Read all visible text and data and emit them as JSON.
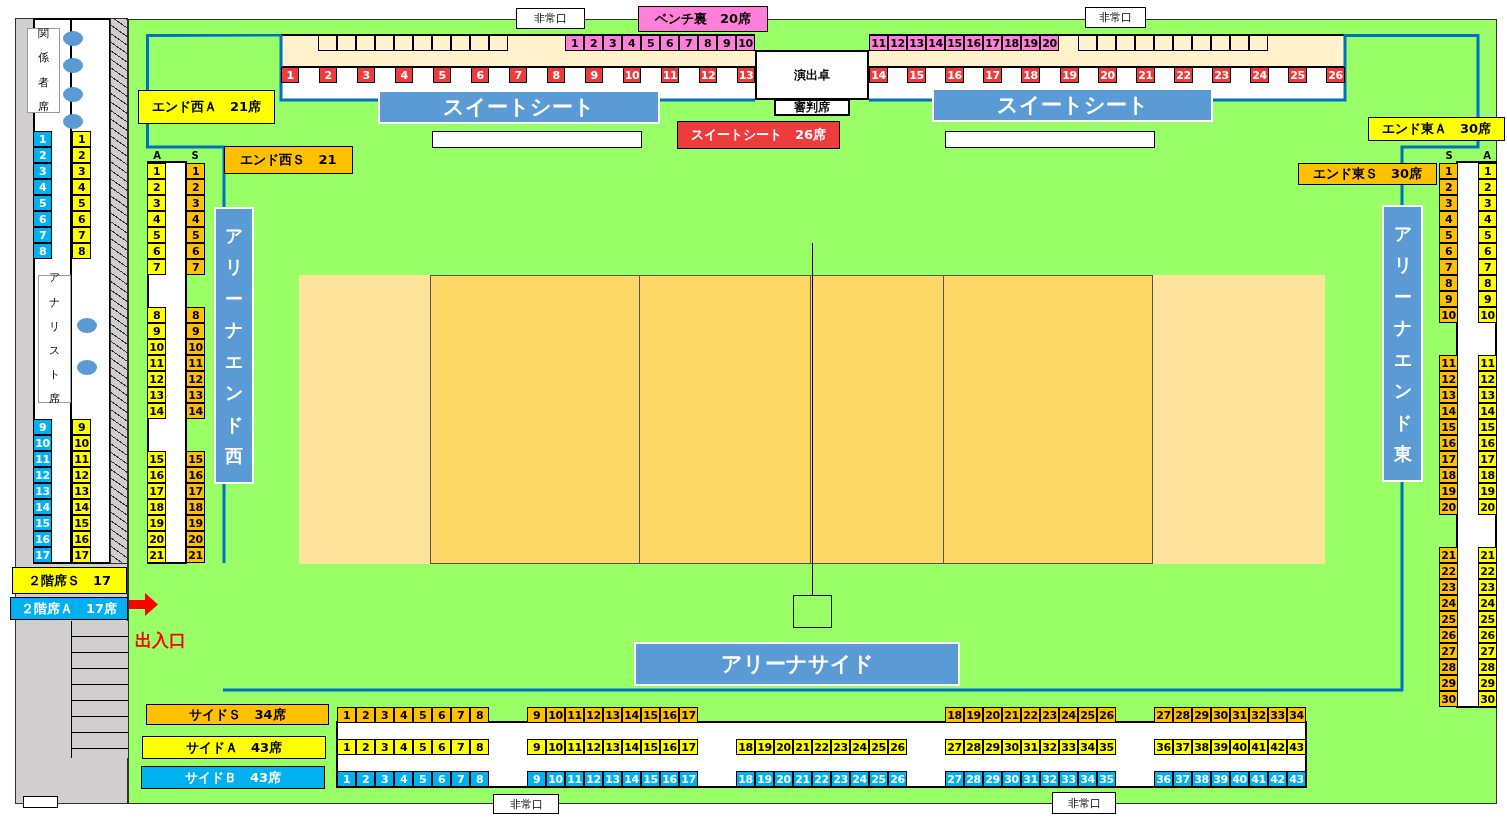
{
  "exits": [
    "非常口",
    "非常口",
    "非常口",
    "非常口"
  ],
  "signs": [
    {
      "text": "ベンチ裏　20席",
      "color": "#ff7fd9"
    },
    {
      "text": "エンド西Ａ　21席",
      "color": "#ffff00"
    },
    {
      "text": "スイートシート　26席",
      "color": "#ee3b3b"
    },
    {
      "text": "エンド東Ａ　30席",
      "color": "#ffff00"
    },
    {
      "text": "エンド西Ｓ　21",
      "color": "#ffc000"
    },
    {
      "text": "エンド東Ｓ　30席",
      "color": "#ffc000"
    },
    {
      "text": "２階席Ｓ　17",
      "color": "#ffff00"
    },
    {
      "text": "２階席Ａ　17席",
      "color": "#00b0f0"
    },
    {
      "text": "サイドＳ　34席",
      "color": "#ffc000"
    },
    {
      "text": "サイドＡ　43席",
      "color": "#ffff00"
    },
    {
      "text": "サイドＢ　43席",
      "color": "#00b0f0"
    }
  ],
  "zones": [
    {
      "text": "スイートシート",
      "kind": "horizontal"
    },
    {
      "text": "スイートシート",
      "kind": "horizontal"
    },
    {
      "text": "アリーナエンド西",
      "kind": "vertical"
    },
    {
      "text": "アリーナエンド東",
      "kind": "vertical"
    },
    {
      "text": "アリーナサイド",
      "kind": "horizontal"
    }
  ],
  "rooms": [
    {
      "text": "関係者席",
      "kind": "vertical"
    },
    {
      "text": "アナリスト席",
      "kind": "vertical"
    },
    {
      "text": "演出卓",
      "kind": "horizontal"
    },
    {
      "text": "審判席",
      "kind": "horizontal"
    }
  ],
  "column_heads": [
    "A",
    "S",
    "S",
    "A"
  ],
  "entrance": "出入口",
  "seat_blocks": [
    {
      "color": "#ff7fd9",
      "seats": [
        "1",
        "2",
        "3",
        "4",
        "5",
        "6",
        "7",
        "8",
        "9",
        "10"
      ]
    },
    {
      "color": "#ff7fd9",
      "seats": [
        "11",
        "12",
        "13",
        "14",
        "15",
        "16",
        "17",
        "18",
        "19",
        "20"
      ]
    },
    {
      "color": "#ee3b3b",
      "seats": [
        "1",
        "2",
        "3",
        "4",
        "5",
        "6",
        "7",
        "8",
        "9",
        "10",
        "11",
        "12",
        "13"
      ]
    },
    {
      "color": "#ee3b3b",
      "seats": [
        "14",
        "15",
        "16",
        "17",
        "18",
        "19",
        "20",
        "21",
        "22",
        "23",
        "24",
        "25",
        "26"
      ]
    },
    {
      "color": "#00b0f0",
      "seats": [
        "1",
        "2",
        "3",
        "4",
        "5",
        "6",
        "7",
        "8"
      ]
    },
    {
      "color": "#00b0f0",
      "seats": [
        "9",
        "10",
        "11",
        "12",
        "13",
        "14",
        "15",
        "16",
        "17"
      ]
    },
    {
      "color": "#ffff00",
      "seats": [
        "1",
        "2",
        "3",
        "4",
        "5",
        "6",
        "7",
        "8"
      ]
    },
    {
      "color": "#ffff00",
      "seats": [
        "9",
        "10",
        "11",
        "12",
        "13",
        "14",
        "15",
        "16",
        "17"
      ]
    },
    {
      "color": "#ffff00",
      "seats": [
        "1",
        "2",
        "3",
        "4",
        "5",
        "6",
        "7"
      ]
    },
    {
      "color": "#ffff00",
      "seats": [
        "8",
        "9",
        "10",
        "11",
        "12",
        "13",
        "14"
      ]
    },
    {
      "color": "#ffff00",
      "seats": [
        "15",
        "16",
        "17",
        "18",
        "19",
        "20",
        "21"
      ]
    },
    {
      "color": "#ffc000",
      "seats": [
        "1",
        "2",
        "3",
        "4",
        "5",
        "6",
        "7"
      ]
    },
    {
      "color": "#ffc000",
      "seats": [
        "8",
        "9",
        "10",
        "11",
        "12",
        "13",
        "14"
      ]
    },
    {
      "color": "#ffc000",
      "seats": [
        "15",
        "16",
        "17",
        "18",
        "19",
        "20",
        "21"
      ]
    },
    {
      "color": "#ffc000",
      "seats": [
        "1",
        "2",
        "3",
        "4",
        "5",
        "6",
        "7",
        "8",
        "9",
        "10"
      ]
    },
    {
      "color": "#ffc000",
      "seats": [
        "11",
        "12",
        "13",
        "14",
        "15",
        "16",
        "17",
        "18",
        "19",
        "20"
      ]
    },
    {
      "color": "#ffc000",
      "seats": [
        "21",
        "22",
        "23",
        "24",
        "25",
        "26",
        "27",
        "28",
        "29",
        "30"
      ]
    },
    {
      "color": "#ffff00",
      "seats": [
        "1",
        "2",
        "3",
        "4",
        "5",
        "6",
        "7",
        "8",
        "9",
        "10"
      ]
    },
    {
      "color": "#ffff00",
      "seats": [
        "11",
        "12",
        "13",
        "14",
        "15",
        "16",
        "17",
        "18",
        "19",
        "20"
      ]
    },
    {
      "color": "#ffff00",
      "seats": [
        "21",
        "22",
        "23",
        "24",
        "25",
        "26",
        "27",
        "28",
        "29",
        "30"
      ]
    },
    {
      "color": "#ffc000",
      "seats": [
        "1",
        "2",
        "3",
        "4",
        "5",
        "6",
        "7",
        "8"
      ]
    },
    {
      "color": "#ffc000",
      "seats": [
        "9",
        "10",
        "11",
        "12",
        "13",
        "14",
        "15",
        "16",
        "17"
      ]
    },
    {
      "color": "#ffc000",
      "seats": [
        "18",
        "19",
        "20",
        "21",
        "22",
        "23",
        "24",
        "25",
        "26"
      ]
    },
    {
      "color": "#ffc000",
      "seats": [
        "27",
        "28",
        "29",
        "30",
        "31",
        "32",
        "33",
        "34"
      ]
    },
    {
      "color": "#ffff00",
      "seats": [
        "1",
        "2",
        "3",
        "4",
        "5",
        "6",
        "7",
        "8"
      ]
    },
    {
      "color": "#ffff00",
      "seats": [
        "9",
        "10",
        "11",
        "12",
        "13",
        "14",
        "15",
        "16",
        "17"
      ]
    },
    {
      "color": "#ffff00",
      "seats": [
        "18",
        "19",
        "20",
        "21",
        "22",
        "23",
        "24",
        "25",
        "26"
      ]
    },
    {
      "color": "#ffff00",
      "seats": [
        "27",
        "28",
        "29",
        "30",
        "31",
        "32",
        "33",
        "34",
        "35"
      ]
    },
    {
      "color": "#ffff00",
      "seats": [
        "36",
        "37",
        "38",
        "39",
        "40",
        "41",
        "42",
        "43"
      ]
    },
    {
      "color": "#00b0f0",
      "seats": [
        "1",
        "2",
        "3",
        "4",
        "5",
        "6",
        "7",
        "8"
      ]
    },
    {
      "color": "#00b0f0",
      "seats": [
        "9",
        "10",
        "11",
        "12",
        "13",
        "14",
        "15",
        "16",
        "17"
      ]
    },
    {
      "color": "#00b0f0",
      "seats": [
        "18",
        "19",
        "20",
        "21",
        "22",
        "23",
        "24",
        "25",
        "26"
      ]
    },
    {
      "color": "#00b0f0",
      "seats": [
        "27",
        "28",
        "29",
        "30",
        "31",
        "32",
        "33",
        "34",
        "35"
      ]
    },
    {
      "color": "#00b0f0",
      "seats": [
        "36",
        "37",
        "38",
        "39",
        "40",
        "41",
        "42",
        "43"
      ]
    }
  ]
}
